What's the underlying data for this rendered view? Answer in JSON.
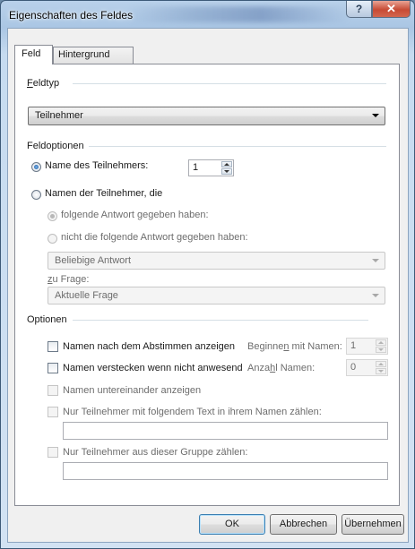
{
  "window": {
    "title": "Eigenschaften des Feldes",
    "help_label": "?",
    "close_label": "✕"
  },
  "tabs": [
    {
      "label": "Feld"
    },
    {
      "label": "Hintergrund"
    }
  ],
  "feldtyp": {
    "heading_accel": "F",
    "heading_rest": "eldtyp",
    "select_value": "Teilnehmer"
  },
  "feldoptionen": {
    "heading": "Feldoptionen",
    "option_name": {
      "label": "Name des Teilnehmers:",
      "value": "1",
      "checked": true
    },
    "option_namen": {
      "label": "Namen der Teilnehmer, die",
      "checked": false
    },
    "sub_folgende": {
      "label": "folgende Antwort gegeben haben:",
      "checked": true
    },
    "sub_nicht": {
      "label": "nicht die folgende Antwort gegeben haben:",
      "checked": false
    },
    "antwort_select": "Beliebige Antwort",
    "zu_frage_accel": "z",
    "zu_frage_rest": "u Frage:",
    "frage_select": "Aktuelle Frage"
  },
  "optionen": {
    "heading": "Optionen",
    "cb_abstimmen": "Namen nach dem Abstimmen anzeigen",
    "beginnen_pre": "Beginne",
    "beginnen_accel": "n",
    "beginnen_post": " mit Namen:",
    "beginnen_value": "1",
    "cb_verstecken": "Namen verstecken wenn nicht anwesend",
    "anzahl_pre": "Anza",
    "anzahl_accel": "h",
    "anzahl_post": "l Namen:",
    "anzahl_value": "0",
    "cb_untereinander": "Namen untereinander anzeigen",
    "cb_text": "Nur Teilnehmer mit folgendem Text in ihrem Namen zählen:",
    "text_value": "",
    "cb_gruppe": "Nur Teilnehmer aus dieser Gruppe zählen:",
    "gruppe_value": ""
  },
  "buttons": {
    "ok": "OK",
    "cancel": "Abbrechen",
    "apply": "Übernehmen"
  }
}
